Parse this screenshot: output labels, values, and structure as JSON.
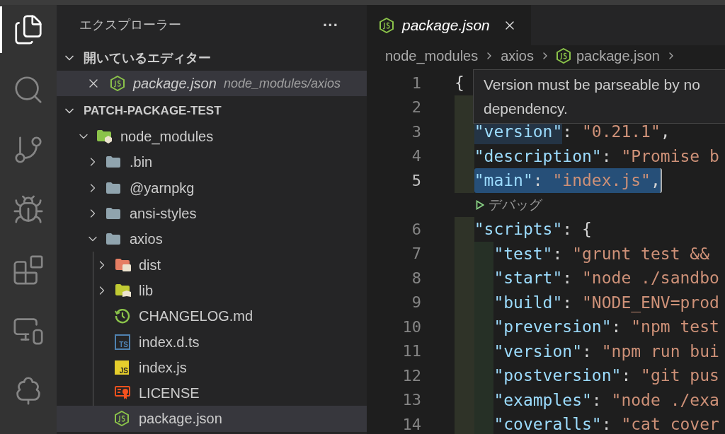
{
  "activity_bar": [
    {
      "kind": "files",
      "selected": true
    },
    {
      "kind": "search",
      "selected": false
    },
    {
      "kind": "git",
      "selected": false
    },
    {
      "kind": "debug",
      "selected": false
    },
    {
      "kind": "extensions",
      "selected": false
    },
    {
      "kind": "remote",
      "selected": false
    },
    {
      "kind": "testing",
      "selected": false
    }
  ],
  "sidebar": {
    "title": "エクスプローラー",
    "more": "···",
    "open_editors": {
      "title": "開いているエディター",
      "expanded": true,
      "items": [
        {
          "name": "package.json",
          "path": "node_modules/axios",
          "kind": "package",
          "selected": true
        }
      ]
    },
    "project": {
      "title": "PATCH-PACKAGE-TEST",
      "expanded": true,
      "tree": [
        {
          "name": "node_modules",
          "kind": "modules",
          "expanded": true,
          "selected": false,
          "children": [
            {
              "name": ".bin",
              "kind": "folder",
              "expanded": false,
              "selected": false
            },
            {
              "name": "@yarnpkg",
              "kind": "folder",
              "expanded": false,
              "selected": false
            },
            {
              "name": "ansi-styles",
              "kind": "folder",
              "expanded": false,
              "selected": false
            },
            {
              "name": "axios",
              "kind": "folder",
              "expanded": true,
              "selected": false,
              "children": [
                {
                  "name": "dist",
                  "kind": "dist",
                  "expanded": false,
                  "selected": false
                },
                {
                  "name": "lib",
                  "kind": "lib",
                  "expanded": false,
                  "selected": false
                },
                {
                  "name": "CHANGELOG.md",
                  "kind": "changelog",
                  "selected": false
                },
                {
                  "name": "index.d.ts",
                  "kind": "typescript",
                  "icon_label": "TS",
                  "selected": false
                },
                {
                  "name": "index.js",
                  "kind": "javascript",
                  "icon_label": "JS",
                  "selected": false
                },
                {
                  "name": "LICENSE",
                  "kind": "license",
                  "selected": false
                },
                {
                  "name": "package.json",
                  "kind": "package",
                  "selected": true
                }
              ]
            }
          ]
        }
      ]
    }
  },
  "editor": {
    "tabs": [
      {
        "name": "package.json",
        "kind": "package",
        "selected": true
      }
    ],
    "breadcrumb": [
      {
        "text": "node_modules"
      },
      {
        "text": "axios"
      },
      {
        "text": "package.json",
        "kind": "package"
      }
    ],
    "lines": [
      {
        "kind": "code",
        "number": "1",
        "selected": false,
        "tokens": [
          {
            "kind": "punct",
            "text": "{"
          }
        ],
        "children": [
          {
            "kind": "code",
            "number": "2",
            "selected": false
          },
          {
            "kind": "code",
            "number": "3",
            "selected": false,
            "tokens": [
              {
                "kind": "key",
                "text": "\"version\"",
                "highlighted": true
              },
              {
                "kind": "punct",
                "text": ": "
              },
              {
                "kind": "string",
                "text": "\"0.21.1\""
              },
              {
                "kind": "punct",
                "text": ","
              }
            ]
          },
          {
            "kind": "code",
            "number": "4",
            "selected": false,
            "tokens": [
              {
                "kind": "key",
                "text": "\"description\""
              },
              {
                "kind": "punct",
                "text": ": "
              },
              {
                "kind": "string",
                "text": "\"Promise b"
              }
            ]
          },
          {
            "kind": "code",
            "number": "5",
            "selected": true,
            "tokens": [
              {
                "kind": "key",
                "text": "\"main\""
              },
              {
                "kind": "punct",
                "text": ": "
              },
              {
                "kind": "string",
                "text": "\"index.js\""
              },
              {
                "kind": "punct",
                "text": ","
              }
            ]
          },
          {
            "kind": "codelens",
            "text": "デバッグ"
          },
          {
            "kind": "code",
            "number": "6",
            "selected": false,
            "tokens": [
              {
                "kind": "key",
                "text": "\"scripts\""
              },
              {
                "kind": "punct",
                "text": ": {"
              }
            ],
            "children": [
              {
                "kind": "code",
                "number": "7",
                "selected": false,
                "tokens": [
                  {
                    "kind": "key",
                    "text": "\"test\""
                  },
                  {
                    "kind": "punct",
                    "text": ": "
                  },
                  {
                    "kind": "string",
                    "text": "\"grunt test &&"
                  }
                ]
              },
              {
                "kind": "code",
                "number": "8",
                "selected": false,
                "tokens": [
                  {
                    "kind": "key",
                    "text": "\"start\""
                  },
                  {
                    "kind": "punct",
                    "text": ": "
                  },
                  {
                    "kind": "string",
                    "text": "\"node ./sandbo"
                  }
                ]
              },
              {
                "kind": "code",
                "number": "9",
                "selected": false,
                "tokens": [
                  {
                    "kind": "key",
                    "text": "\"build\""
                  },
                  {
                    "kind": "punct",
                    "text": ": "
                  },
                  {
                    "kind": "string",
                    "text": "\"NODE_ENV=prod"
                  }
                ]
              },
              {
                "kind": "code",
                "number": "10",
                "selected": false,
                "tokens": [
                  {
                    "kind": "key",
                    "text": "\"preversion\""
                  },
                  {
                    "kind": "punct",
                    "text": ": "
                  },
                  {
                    "kind": "string",
                    "text": "\"npm test"
                  }
                ]
              },
              {
                "kind": "code",
                "number": "11",
                "selected": false,
                "tokens": [
                  {
                    "kind": "key",
                    "text": "\"version\""
                  },
                  {
                    "kind": "punct",
                    "text": ": "
                  },
                  {
                    "kind": "string",
                    "text": "\"npm run bui"
                  }
                ]
              },
              {
                "kind": "code",
                "number": "12",
                "selected": false,
                "tokens": [
                  {
                    "kind": "key",
                    "text": "\"postversion\""
                  },
                  {
                    "kind": "punct",
                    "text": ": "
                  },
                  {
                    "kind": "string",
                    "text": "\"git pus"
                  }
                ]
              },
              {
                "kind": "code",
                "number": "13",
                "selected": false,
                "tokens": [
                  {
                    "kind": "key",
                    "text": "\"examples\""
                  },
                  {
                    "kind": "punct",
                    "text": ": "
                  },
                  {
                    "kind": "string",
                    "text": "\"node ./exa"
                  }
                ]
              },
              {
                "kind": "code",
                "number": "14",
                "selected": false,
                "tokens": [
                  {
                    "kind": "key",
                    "text": "\"coveralls\""
                  },
                  {
                    "kind": "punct",
                    "text": ": "
                  },
                  {
                    "kind": "string",
                    "text": "\"cat cover"
                  }
                ]
              }
            ]
          }
        ]
      }
    ],
    "hover": {
      "lines": [
        "Version must be parseable by no",
        "dependency."
      ]
    }
  }
}
